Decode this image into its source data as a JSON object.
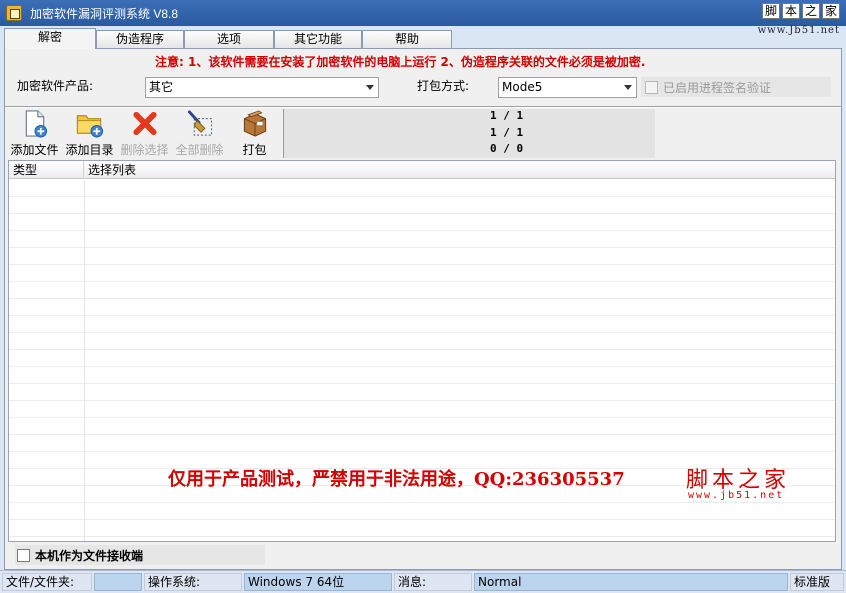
{
  "window": {
    "title": "加密软件漏洞评测系统  V8.8",
    "logo_chars": [
      "脚",
      "本",
      "之",
      "家"
    ],
    "logo_url": "www.Jb51.net"
  },
  "tabs": [
    {
      "label": "解密",
      "active": true
    },
    {
      "label": "伪造程序",
      "active": false
    },
    {
      "label": "选项",
      "active": false
    },
    {
      "label": "其它功能",
      "active": false
    },
    {
      "label": "帮助",
      "active": false
    }
  ],
  "notice": "注意: 1、该软件需要在安装了加密软件的电脑上运行  2、伪造程序关联的文件必须是被加密.",
  "form": {
    "product_label": "加密软件产品:",
    "product_value": "其它",
    "pack_label": "打包方式:",
    "pack_value": "Mode5",
    "verify_label": "已启用进程签名验证"
  },
  "toolbar": {
    "add_file": "添加文件",
    "add_dir": "添加目录",
    "delete_selected": "删除选择",
    "delete_all": "全部删除",
    "pack": "打包"
  },
  "counters": [
    "1 / 1",
    "1 / 1",
    "0 / 0"
  ],
  "list": {
    "col_type": "类型",
    "col_list": "选择列表"
  },
  "watermark": {
    "text": "仅用于产品测试，严禁用于非法用途，QQ:236305537",
    "logo": "脚本之家",
    "url": "www.jb51.net"
  },
  "receiver_label": "本机作为文件接收端",
  "status": {
    "file_label": "文件/文件夹:",
    "file_value": "",
    "os_label": "操作系统:",
    "os_value": "Windows 7 64位",
    "msg_label": "消息:",
    "msg_value": "Normal",
    "edition": "标准版"
  },
  "colors": {
    "title_bar": "#2f62aa",
    "notice_red": "#d20000",
    "watermark_red": "#d40000",
    "status_blue": "#bcd4ee"
  }
}
